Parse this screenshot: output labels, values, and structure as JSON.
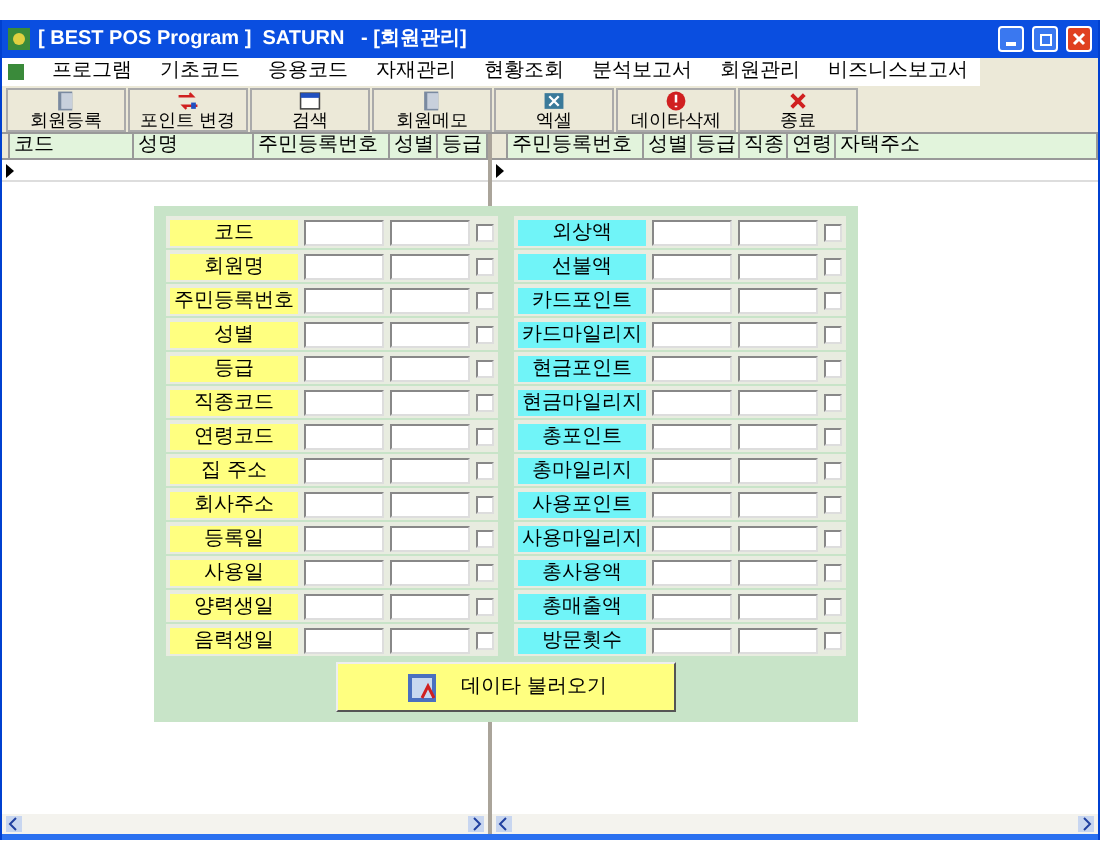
{
  "window": {
    "title": "[ BEST POS Program ]  SATURN   - [회원관리]"
  },
  "menu": [
    "프로그램",
    "기초코드",
    "응용코드",
    "자재관리",
    "현황조회",
    "분석보고서",
    "회원관리",
    "비즈니스보고서"
  ],
  "toolbar": [
    {
      "label": "회원등록",
      "kind": "book"
    },
    {
      "label": "포인트 변경",
      "kind": "swap"
    },
    {
      "label": "검색",
      "kind": "window"
    },
    {
      "label": "회원메모",
      "kind": "book"
    },
    {
      "label": "엑셀",
      "kind": "excel"
    },
    {
      "label": "데이타삭제",
      "kind": "delete"
    },
    {
      "label": "종료",
      "kind": "exit"
    }
  ],
  "left_grid": {
    "columns": [
      "코드",
      "성명",
      "주민등록번호",
      "성별",
      "등급"
    ]
  },
  "right_grid": {
    "columns": [
      "주민등록번호",
      "성별",
      "등급",
      "직종",
      "연령",
      "자택주소"
    ]
  },
  "left_fields": [
    {
      "label": "코드",
      "checked": false
    },
    {
      "label": "회원명",
      "checked": false
    },
    {
      "label": "주민등록번호",
      "checked": false
    },
    {
      "label": "성별",
      "checked": false
    },
    {
      "label": "등급",
      "checked": false
    },
    {
      "label": "직종코드",
      "checked": false
    },
    {
      "label": "연령코드",
      "checked": false
    },
    {
      "label": "집 주소",
      "checked": false
    },
    {
      "label": "회사주소",
      "checked": false
    },
    {
      "label": "등록일",
      "checked": false
    },
    {
      "label": "사용일",
      "checked": false
    },
    {
      "label": "양력생일",
      "checked": false
    },
    {
      "label": "음력생일",
      "checked": false
    }
  ],
  "right_fields": [
    {
      "label": "외상액",
      "checked": false
    },
    {
      "label": "선불액",
      "checked": false
    },
    {
      "label": "카드포인트",
      "checked": false
    },
    {
      "label": "카드마일리지",
      "checked": false
    },
    {
      "label": "현금포인트",
      "checked": false
    },
    {
      "label": "현금마일리지",
      "checked": false
    },
    {
      "label": "총포인트",
      "checked": false
    },
    {
      "label": "총마일리지",
      "checked": false
    },
    {
      "label": "사용포인트",
      "checked": false
    },
    {
      "label": "사용마일리지",
      "checked": false
    },
    {
      "label": "총사용액",
      "checked": false
    },
    {
      "label": "총매출액",
      "checked": false
    },
    {
      "label": "방문횟수",
      "checked": false
    }
  ],
  "load_button": {
    "label": "데이타 불러오기"
  }
}
